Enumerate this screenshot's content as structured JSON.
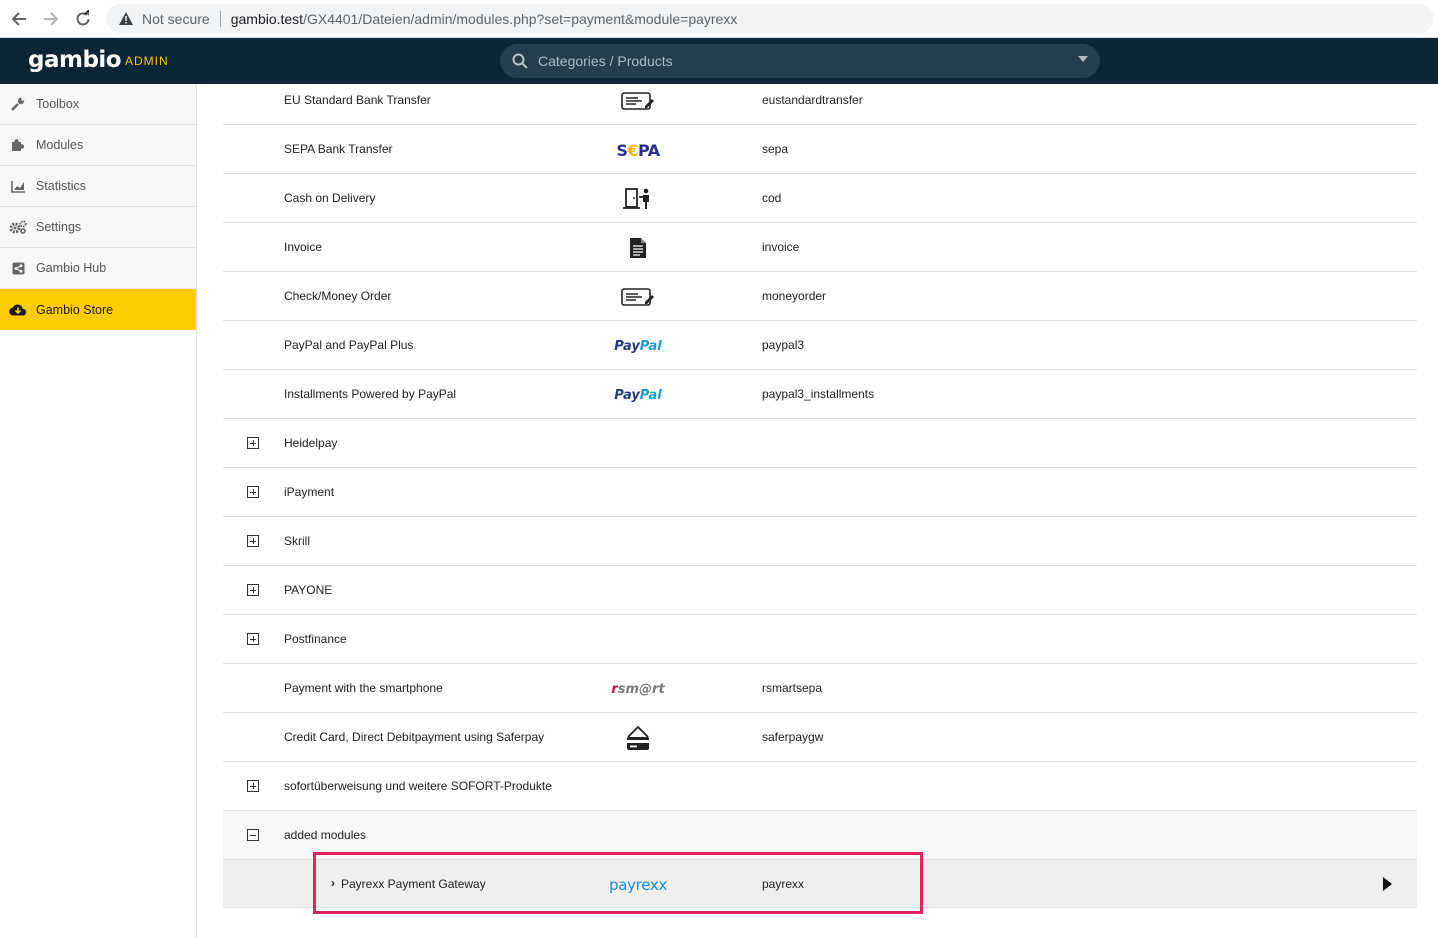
{
  "browser": {
    "security_label": "Not secure",
    "url_host": "gambio.test",
    "url_path": "/GX4401/Dateien/admin/modules.php?set=payment&module=payrexx"
  },
  "header": {
    "logo": "gambio",
    "admin_label": "ADMIN",
    "search_placeholder": "Categories / Products"
  },
  "sidebar": {
    "items": [
      {
        "label": "Toolbox",
        "icon": "wrench-icon"
      },
      {
        "label": "Modules",
        "icon": "puzzle-icon"
      },
      {
        "label": "Statistics",
        "icon": "chart-icon"
      },
      {
        "label": "Settings",
        "icon": "gears-icon"
      },
      {
        "label": "Gambio Hub",
        "icon": "share-icon"
      },
      {
        "label": "Gambio Store",
        "icon": "cloud-download-icon",
        "active": true
      }
    ]
  },
  "modules": {
    "rows": [
      {
        "name": "EU Standard Bank Transfer",
        "logo": "transfer-icon",
        "code": "eustandardtransfer"
      },
      {
        "name": "SEPA Bank Transfer",
        "logo_text": "SEPA",
        "code": "sepa"
      },
      {
        "name": "Cash on Delivery",
        "logo": "delivery-icon",
        "code": "cod"
      },
      {
        "name": "Invoice",
        "logo": "invoice-icon",
        "code": "invoice"
      },
      {
        "name": "Check/Money Order",
        "logo": "transfer-icon",
        "code": "moneyorder"
      },
      {
        "name": "PayPal and PayPal Plus",
        "logo_text": "PayPal",
        "code": "paypal3"
      },
      {
        "name": "Installments Powered by PayPal",
        "logo_text": "PayPal",
        "code": "paypal3_installments"
      },
      {
        "name": "Heidelpay",
        "group": "collapsed"
      },
      {
        "name": "iPayment",
        "group": "collapsed"
      },
      {
        "name": "Skrill",
        "group": "collapsed"
      },
      {
        "name": "PAYONE",
        "group": "collapsed"
      },
      {
        "name": "Postfinance",
        "group": "collapsed"
      },
      {
        "name": "Payment with the smartphone",
        "logo_text": "rsm@rt",
        "code": "rsmartsepa"
      },
      {
        "name": "Credit Card, Direct Debitpayment using Saferpay",
        "logo": "card-icon",
        "code": "saferpaygw"
      },
      {
        "name": "sofortüberweisung und weitere SOFORT-Produkte",
        "group": "collapsed"
      },
      {
        "name": "added modules",
        "group": "expanded"
      }
    ],
    "selected": {
      "name": "Payrexx Payment Gateway",
      "logo_text": "payrexx",
      "code": "payrexx"
    }
  },
  "colors": {
    "header_bg": "#0c2537",
    "accent": "#ffcc00",
    "highlight": "#e0245e"
  }
}
